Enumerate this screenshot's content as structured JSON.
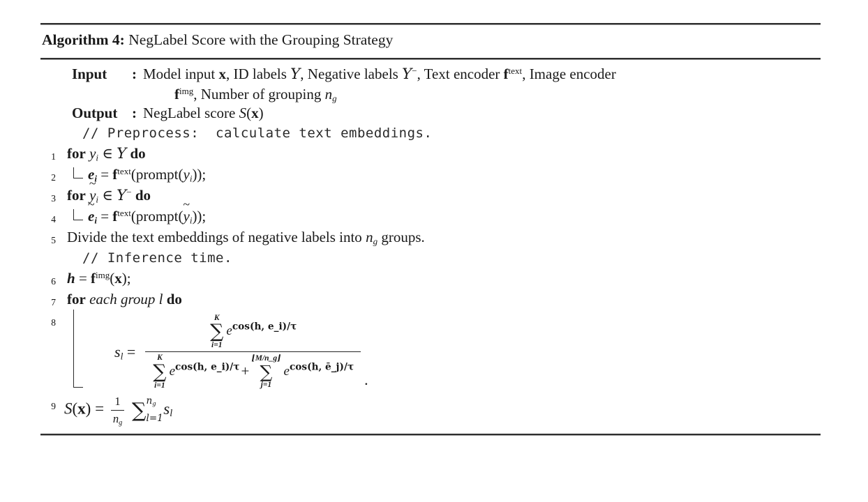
{
  "algorithm": {
    "label": "Algorithm 4:",
    "title": "NegLabel Score with the Grouping Strategy",
    "io": {
      "input_key": "Input",
      "output_key": "Output",
      "colon": ":",
      "input_line1_prefix": "Model input ",
      "input_line1_x": "x",
      "input_line1_mid1": ", ID labels ",
      "input_line1_Y": "Y",
      "input_line1_mid2": ", Negative labels ",
      "input_line1_Yneg": "Y",
      "input_line1_negsup": "−",
      "input_line1_mid3": ", Text encoder ",
      "input_line1_f": "f",
      "input_line1_fsup": "text",
      "input_line1_tail": ", Image encoder",
      "input_line2_f": "f",
      "input_line2_fsup": "img",
      "input_line2_mid": ", Number of grouping ",
      "input_line2_n": "n",
      "input_line2_nsub": "g",
      "output_text_prefix": "NegLabel score ",
      "output_S": "S",
      "output_paren_open": "(",
      "output_x": "x",
      "output_paren_close": ")"
    },
    "comments": {
      "preprocess": "// Preprocess:  calculate text embeddings.",
      "inference": "// Inference time."
    },
    "lines": [
      {
        "no": "1",
        "kind": "for",
        "kw_for": "for",
        "var": "y",
        "var_sub": "i",
        "in": "∈",
        "set": "Y",
        "set_sup": "",
        "kw_do": "do"
      },
      {
        "no": "2",
        "kind": "assign",
        "lhs": "e",
        "lhs_sub": "i",
        "eq": "=",
        "fn": "f",
        "fn_sup": "text",
        "open": "(prompt(",
        "arg": "y",
        "arg_sub": "i",
        "close": "));"
      },
      {
        "no": "3",
        "kind": "for",
        "kw_for": "for",
        "var": "y",
        "var_sub": "i",
        "var_accent": "~",
        "in": "∈",
        "set": "Y",
        "set_sup": "−",
        "kw_do": "do"
      },
      {
        "no": "4",
        "kind": "assign",
        "lhs": "e",
        "lhs_sub": "i",
        "lhs_accent": "~",
        "eq": "=",
        "fn": "f",
        "fn_sup": "text",
        "open": "(prompt(",
        "arg": "y",
        "arg_sub": "i",
        "arg_accent": "~",
        "close": "));"
      },
      {
        "no": "5",
        "kind": "text",
        "text_a": "Divide the text embeddings of negative labels into ",
        "sym_n": "n",
        "sym_n_sub": "g",
        "text_b": " groups."
      },
      {
        "no": "6",
        "kind": "assign_img",
        "lhs": "h",
        "eq": "=",
        "fn": "f",
        "fn_sup": "img",
        "open": "(",
        "arg": "x",
        "close": ");"
      },
      {
        "no": "7",
        "kind": "for_each",
        "kw_for": "for",
        "phrase": "each group",
        "var": "l",
        "kw_do": "do"
      },
      {
        "no": "8",
        "kind": "fraction",
        "lhs_s": "s",
        "lhs_sub": "l",
        "eq": "=",
        "period": ".",
        "numerator": {
          "sum_upper": "K",
          "sum_lower": "i=1",
          "base": "e",
          "exponent": "cos(h, e_i)/τ"
        },
        "denominator": {
          "term1": {
            "sum_upper": "K",
            "sum_lower": "i=1",
            "base": "e",
            "exponent": "cos(h, e_i)/τ"
          },
          "plus": "+",
          "term2": {
            "sum_upper": "⌊M/n_g⌋",
            "sum_lower": "j=1",
            "base": "e",
            "exponent": "cos(h, ē_j)/τ"
          }
        }
      },
      {
        "no": "9",
        "kind": "final",
        "S": "S",
        "x": "x",
        "eq": "=",
        "frac_num": "1",
        "frac_den_n": "n",
        "frac_den_sub": "g",
        "sum_upper_n": "n",
        "sum_upper_sub": "g",
        "sum_lower": "l=1",
        "s": "s",
        "s_sub": "l"
      }
    ]
  }
}
